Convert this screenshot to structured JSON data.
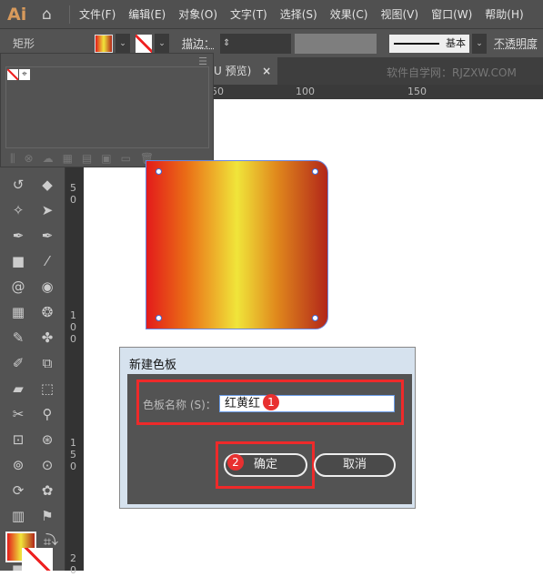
{
  "app": {
    "logo": "Ai",
    "menu": [
      "文件(F)",
      "编辑(E)",
      "对象(O)",
      "文字(T)",
      "选择(S)",
      "效果(C)",
      "视图(V)",
      "窗口(W)",
      "帮助(H)"
    ]
  },
  "control": {
    "object_type": "矩形",
    "stroke_label": "描边：",
    "stroke_style": "基本",
    "opacity_label": "不透明度"
  },
  "tab": {
    "label": "U 预览)",
    "close": "×",
    "watermark": "软件自学网：RJZXW.COM"
  },
  "ruler": {
    "h": [
      "50",
      "100",
      "150"
    ],
    "v": [
      "5 0",
      "1 0 0",
      "1 5 0",
      "2 0"
    ]
  },
  "tools": [
    "rotate-icon",
    "eraser-icon",
    "magic-wand-icon",
    "lasso-icon",
    "add-anchor-icon",
    "delete-anchor-icon",
    "gradient-icon",
    "eyedropper-icon",
    "spiral-icon",
    "symbol-icon",
    "grid-icon",
    "polar-grid-icon",
    "shaper-icon",
    "puppet-warp-icon",
    "pencil-icon",
    "shape-builder-icon",
    "eraser-tool-icon",
    "artboard-icon",
    "scissors-icon",
    "zoom-icon",
    "symbol-sprayer-icon",
    "symbol-shifter-icon",
    "symbol-scruncher-icon",
    "symbol-sizer-icon",
    "symbol-spinner-icon",
    "symbol-stainer-icon",
    "perspective-grid-icon",
    "flag-icon",
    "perspective-select-icon",
    "slice-icon",
    "measure-icon"
  ],
  "colors": {
    "accent_red": "#ee2a2a",
    "dialog_title_bg": "#d6e2ee",
    "gradient": [
      "#e31b1b",
      "#ea6d16",
      "#f0e53a",
      "#e0881c",
      "#b2261a"
    ]
  },
  "dialog": {
    "title": "新建色板",
    "name_label": "色板名称 (S)：",
    "name_value": "红黄红",
    "ok": "确定",
    "cancel": "取消",
    "badge1": "1",
    "badge2": "2"
  }
}
